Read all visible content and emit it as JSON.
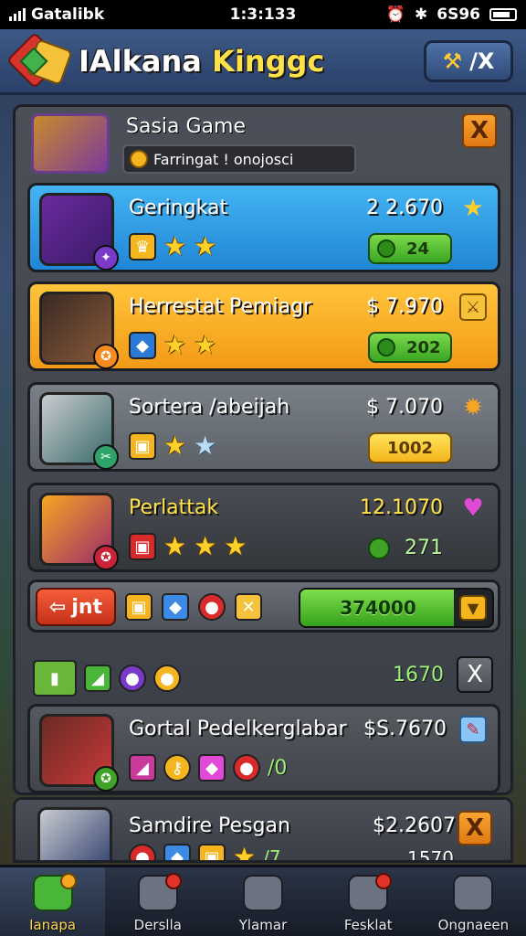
{
  "status_bar": {
    "carrier": "Gatalibk",
    "time": "1:3:133",
    "battery_text": "6S96"
  },
  "header": {
    "title_part1": "IAlkana",
    "title_part2": "Kinggc",
    "action_label": "/X",
    "colors": {
      "title": "#ffe14a",
      "header_bg": "#2a4068"
    }
  },
  "quest": {
    "title": "Sasia Game",
    "subtitle": "Farringat ! onojosci",
    "close_label": "X"
  },
  "cards": [
    {
      "name": "Geringkat",
      "price": "2 2.670",
      "badge_value": "24",
      "stars": 2,
      "style": "blue",
      "corner_icon": "star-icon"
    },
    {
      "name": "Herrestat Pemiagr",
      "price": "$ 7.970",
      "badge_value": "202",
      "stars": 2,
      "style": "orange",
      "corner_icon": "sword-icon"
    },
    {
      "name": "Sortera /abeijah",
      "price": "$ 7.070",
      "badge_value": "1002",
      "stars": 2,
      "style": "gray",
      "corner_icon": "bomb-icon"
    },
    {
      "name": "Perlattak",
      "price": "12.1070",
      "badge_value": "271",
      "stars": 3,
      "style": "dark",
      "corner_icon": "heart-icon"
    }
  ],
  "action_row": {
    "join_label": "jnt",
    "progress_value": "374000",
    "progress_fraction": 0.8
  },
  "item_row": {
    "count": "1670",
    "close_label": "X"
  },
  "featured_card": {
    "name": "Gortal Pedelkerglabar",
    "price": "$S.7670",
    "item_count": "/0"
  },
  "peek_card": {
    "name": "Samdire Pesgan",
    "price": "$2.2607",
    "count": "1570",
    "star_count_label": "/7",
    "close_label": "X"
  },
  "bottom_nav": [
    {
      "label": "Ianapa",
      "active": true
    },
    {
      "label": "Derslla",
      "active": false
    },
    {
      "label": "Ylamar",
      "active": false
    },
    {
      "label": "Fesklat",
      "active": false
    },
    {
      "label": "Ongnaeen",
      "active": false
    }
  ]
}
